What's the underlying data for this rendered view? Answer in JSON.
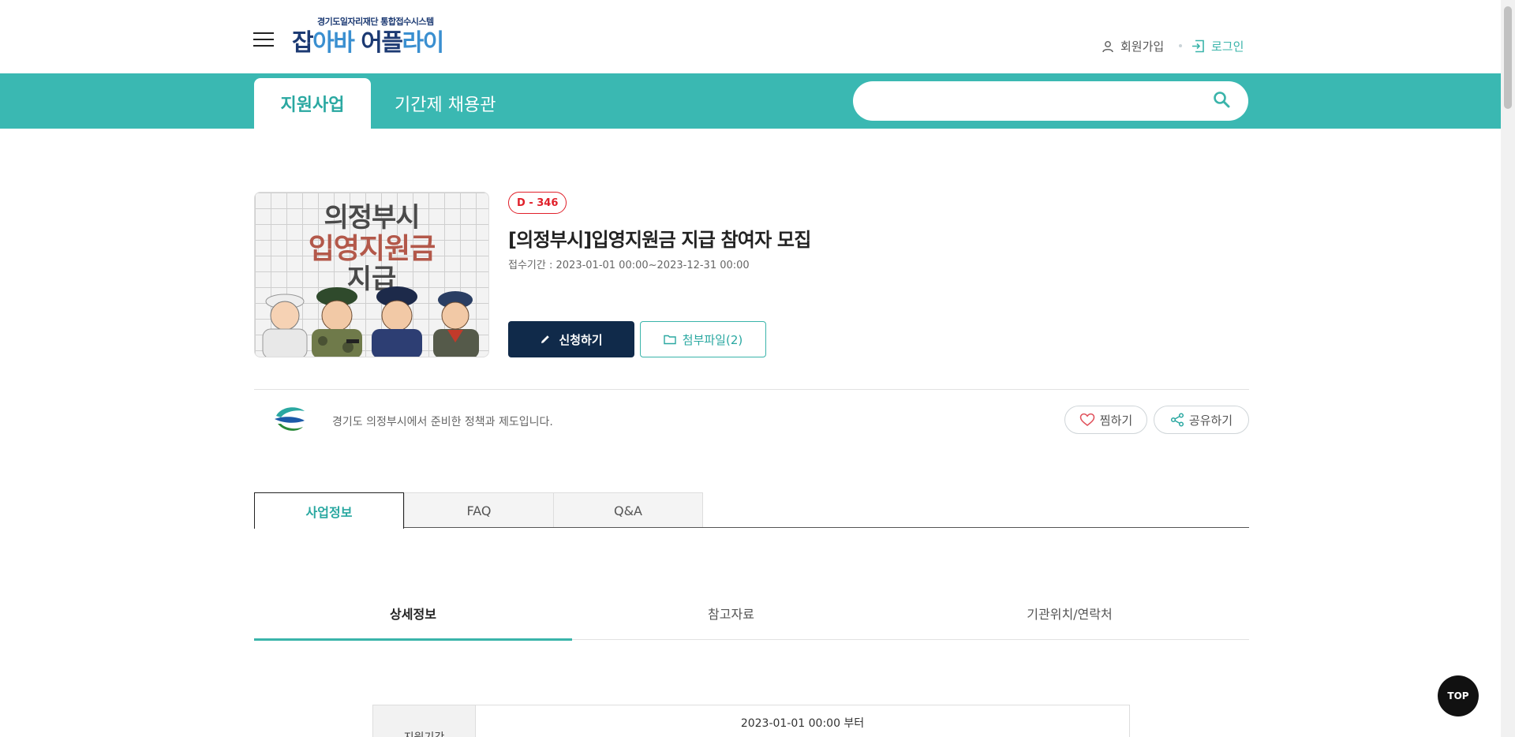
{
  "header": {
    "logo_sub": "경기도일자리재단 통합접수시스템",
    "logo_main_a": "잡",
    "logo_main_b": "아바 ",
    "logo_main_c": "어플",
    "logo_main_d": "라이",
    "signup_label": "회원가입",
    "login_label": "로그인"
  },
  "nav": {
    "tabs": [
      {
        "label": "지원사업",
        "active": true
      },
      {
        "label": "기간제 채용관",
        "active": false
      }
    ],
    "search_placeholder": ""
  },
  "poster": {
    "line1": "의정부시",
    "line2": "입영지원금",
    "line3": "지급"
  },
  "post": {
    "dday": "D - 346",
    "title": "[의정부시]입영지원금 지급 참여자 모집",
    "period_label": "접수기간 :",
    "period_value": "2023-01-01 00:00~2023-12-31 00:00",
    "apply_label": "신청하기",
    "attach_label": "첨부파일(2)"
  },
  "org": {
    "description": "경기도 의정부시에서 준비한 정책과 제도입니다.",
    "wish_label": "찜하기",
    "share_label": "공유하기"
  },
  "tabs": [
    "사업정보",
    "FAQ",
    "Q&A"
  ],
  "subtabs": [
    "상세정보",
    "참고자료",
    "기관위치/연락처"
  ],
  "table": {
    "head": "지원기간",
    "value": "2023-01-01 00:00 부터"
  },
  "top_button": "TOP",
  "colors": {
    "teal": "#3ab8b2",
    "navy": "#102a4a",
    "dday_red": "#e0202a"
  }
}
